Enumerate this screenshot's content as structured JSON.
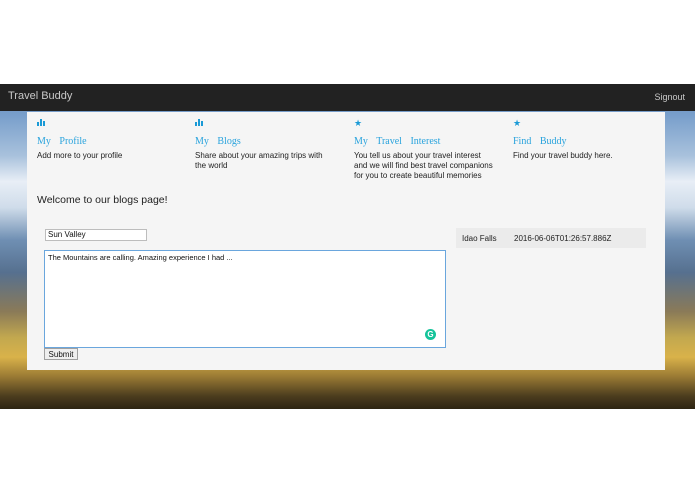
{
  "navbar": {
    "brand": "Travel Buddy",
    "signout": "Signout"
  },
  "features": [
    {
      "icon": "bar-chart-icon",
      "title": "My Profile",
      "description": "Add more to your profile"
    },
    {
      "icon": "bar-chart-icon",
      "title": "My Blogs",
      "description": "Share about your amazing trips with the world"
    },
    {
      "icon": "star-icon",
      "title": "My Travel Interest",
      "description": "You tell us about your travel interest and we will find best travel companions for you to create beautiful memories"
    },
    {
      "icon": "star-icon",
      "title": "Find Buddy",
      "description": "Find your travel buddy here."
    }
  ],
  "welcome": "Welcome to our blogs page!",
  "form": {
    "title_value": "Sun Valley",
    "content_value": "The Mountains are calling. Amazing experience I had ...",
    "submit_label": "Submit"
  },
  "blog_list": [
    {
      "title": "Idao Falls",
      "timestamp": "2016-06-06T01:26:57.886Z"
    }
  ],
  "colors": {
    "accent": "#29a3dd",
    "navbar": "#222222",
    "panel": "#f5f5f5"
  }
}
